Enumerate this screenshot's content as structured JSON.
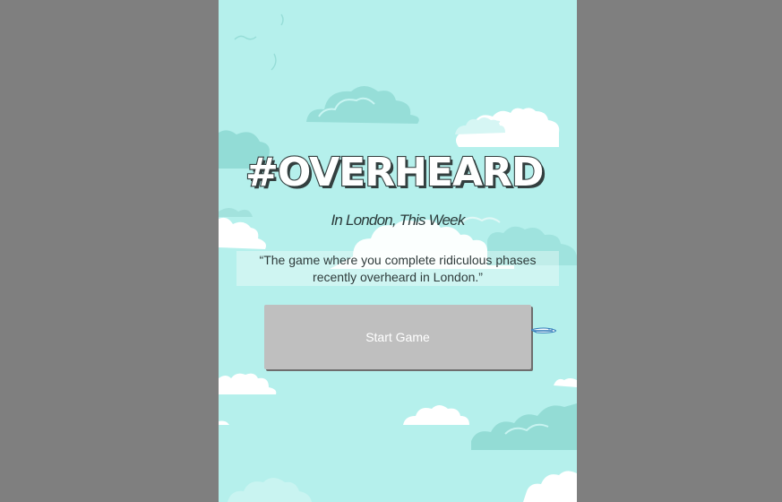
{
  "game": {
    "logo_text": "#OVERHEARD",
    "subtitle": "In London, This Week",
    "tagline_line1": "“The game where you complete ridiculous phases",
    "tagline_line2": "recently overheard in London.”",
    "start_label": "Start Game"
  },
  "colors": {
    "outer_background": "#7f7f7f",
    "sky": "#b5f0ec",
    "cloud_white": "#ffffff",
    "cloud_blue": "#8fdcd8",
    "logo_outline": "#333f3f",
    "button_bg": "#bfbfbf",
    "button_text": "#ffffff"
  },
  "icons": {
    "airplane": "airplane-icon",
    "clouds": "cloud-icon"
  }
}
